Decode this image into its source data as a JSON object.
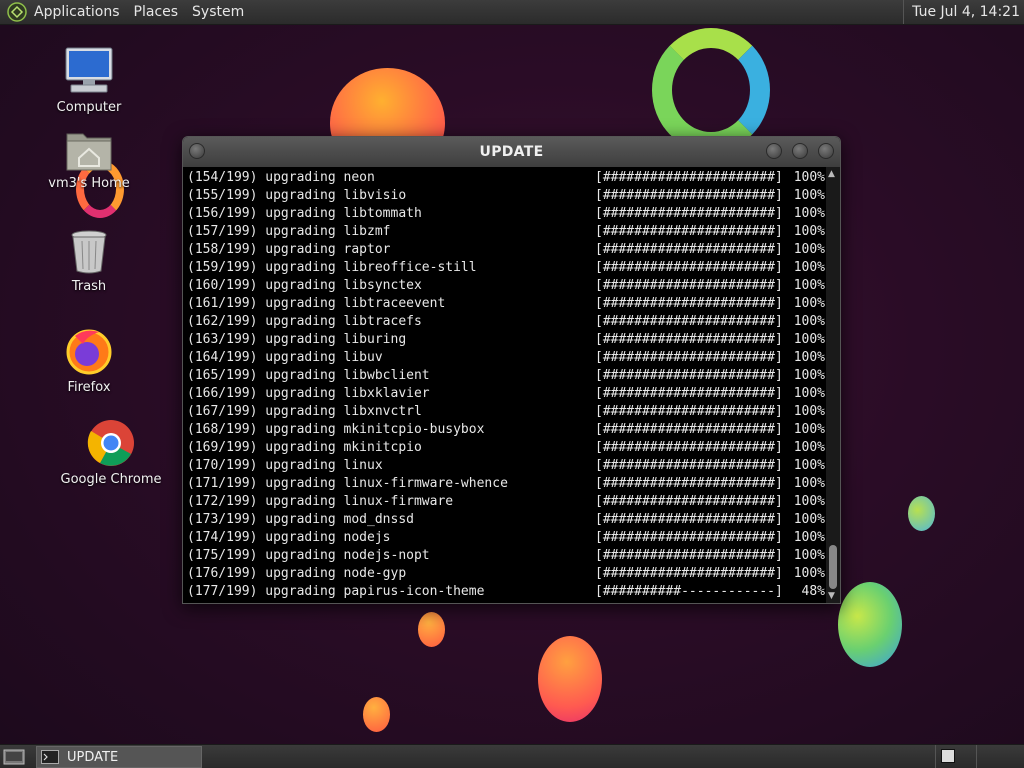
{
  "top_panel": {
    "menus": [
      "Applications",
      "Places",
      "System"
    ],
    "clock": "Tue Jul  4, 14:21"
  },
  "desktop_icons": [
    {
      "label": "Computer",
      "icon": "computer-icon"
    },
    {
      "label": "vm3's Home",
      "icon": "home-folder-icon"
    },
    {
      "label": "Trash",
      "icon": "trash-icon"
    },
    {
      "label": "Firefox",
      "icon": "firefox-icon"
    },
    {
      "label": "Google Chrome",
      "icon": "chrome-icon"
    }
  ],
  "window": {
    "title": "UPDATE",
    "lines": [
      {
        "text": "(154/199) upgrading neon",
        "bar": "[######################]",
        "pct": "100%"
      },
      {
        "text": "(155/199) upgrading libvisio",
        "bar": "[######################]",
        "pct": "100%"
      },
      {
        "text": "(156/199) upgrading libtommath",
        "bar": "[######################]",
        "pct": "100%"
      },
      {
        "text": "(157/199) upgrading libzmf",
        "bar": "[######################]",
        "pct": "100%"
      },
      {
        "text": "(158/199) upgrading raptor",
        "bar": "[######################]",
        "pct": "100%"
      },
      {
        "text": "(159/199) upgrading libreoffice-still",
        "bar": "[######################]",
        "pct": "100%"
      },
      {
        "text": "(160/199) upgrading libsynctex",
        "bar": "[######################]",
        "pct": "100%"
      },
      {
        "text": "(161/199) upgrading libtraceevent",
        "bar": "[######################]",
        "pct": "100%"
      },
      {
        "text": "(162/199) upgrading libtracefs",
        "bar": "[######################]",
        "pct": "100%"
      },
      {
        "text": "(163/199) upgrading liburing",
        "bar": "[######################]",
        "pct": "100%"
      },
      {
        "text": "(164/199) upgrading libuv",
        "bar": "[######################]",
        "pct": "100%"
      },
      {
        "text": "(165/199) upgrading libwbclient",
        "bar": "[######################]",
        "pct": "100%"
      },
      {
        "text": "(166/199) upgrading libxklavier",
        "bar": "[######################]",
        "pct": "100%"
      },
      {
        "text": "(167/199) upgrading libxnvctrl",
        "bar": "[######################]",
        "pct": "100%"
      },
      {
        "text": "(168/199) upgrading mkinitcpio-busybox",
        "bar": "[######################]",
        "pct": "100%"
      },
      {
        "text": "(169/199) upgrading mkinitcpio",
        "bar": "[######################]",
        "pct": "100%"
      },
      {
        "text": "(170/199) upgrading linux",
        "bar": "[######################]",
        "pct": "100%"
      },
      {
        "text": "(171/199) upgrading linux-firmware-whence",
        "bar": "[######################]",
        "pct": "100%"
      },
      {
        "text": "(172/199) upgrading linux-firmware",
        "bar": "[######################]",
        "pct": "100%"
      },
      {
        "text": "(173/199) upgrading mod_dnssd",
        "bar": "[######################]",
        "pct": "100%"
      },
      {
        "text": "(174/199) upgrading nodejs",
        "bar": "[######################]",
        "pct": "100%"
      },
      {
        "text": "(175/199) upgrading nodejs-nopt",
        "bar": "[######################]",
        "pct": "100%"
      },
      {
        "text": "(176/199) upgrading node-gyp",
        "bar": "[######################]",
        "pct": "100%"
      },
      {
        "text": "(177/199) upgrading papirus-icon-theme",
        "bar": "[##########------------]",
        "pct": " 48%"
      }
    ]
  },
  "taskbar": {
    "task_label": "UPDATE"
  }
}
